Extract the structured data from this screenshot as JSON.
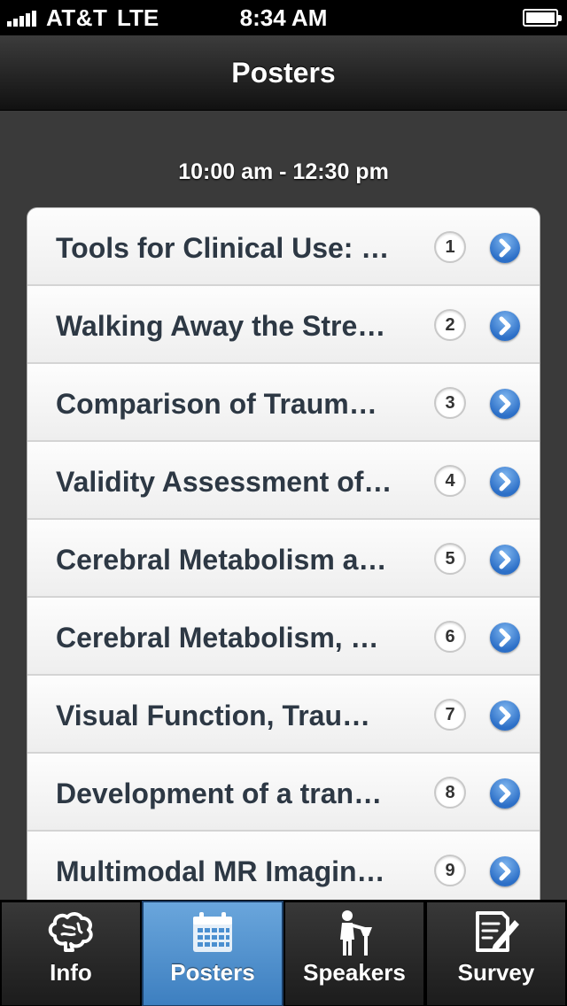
{
  "status_bar": {
    "carrier": "AT&T",
    "network": "LTE",
    "time": "8:34 AM"
  },
  "nav_bar": {
    "title": "Posters"
  },
  "section": {
    "header": "10:00 am - 12:30 pm"
  },
  "posters": [
    {
      "title": "Tools for Clinical Use: …",
      "number": "1",
      "icon": "chevron-right-icon"
    },
    {
      "title": "Walking Away the Stres…",
      "number": "2",
      "icon": "chevron-right-icon"
    },
    {
      "title": "Comparison of Traumat…",
      "number": "3",
      "icon": "chevron-right-icon"
    },
    {
      "title": "Validity Assessment of …",
      "number": "4",
      "icon": "chevron-right-icon"
    },
    {
      "title": "Cerebral Metabolism an…",
      "number": "5",
      "icon": "chevron-right-icon"
    },
    {
      "title": "Cerebral Metabolism, M…",
      "number": "6",
      "icon": "chevron-right-icon"
    },
    {
      "title": "Visual Function, Traum…",
      "number": "7",
      "icon": "chevron-right-icon"
    },
    {
      "title": "Development of a transl…",
      "number": "8",
      "icon": "chevron-right-icon"
    },
    {
      "title": "Multimodal MR Imaging…",
      "number": "9",
      "icon": "chevron-right-icon"
    }
  ],
  "tabs": [
    {
      "label": "Info",
      "icon": "brain-icon",
      "active": false
    },
    {
      "label": "Posters",
      "icon": "calendar-icon",
      "active": true
    },
    {
      "label": "Speakers",
      "icon": "speaker-podium-icon",
      "active": false
    },
    {
      "label": "Survey",
      "icon": "survey-edit-icon",
      "active": false
    }
  ],
  "colors": {
    "accent": "#4a8fd0",
    "disclosure": "#2c6fc7",
    "title_text": "#2d3844"
  }
}
